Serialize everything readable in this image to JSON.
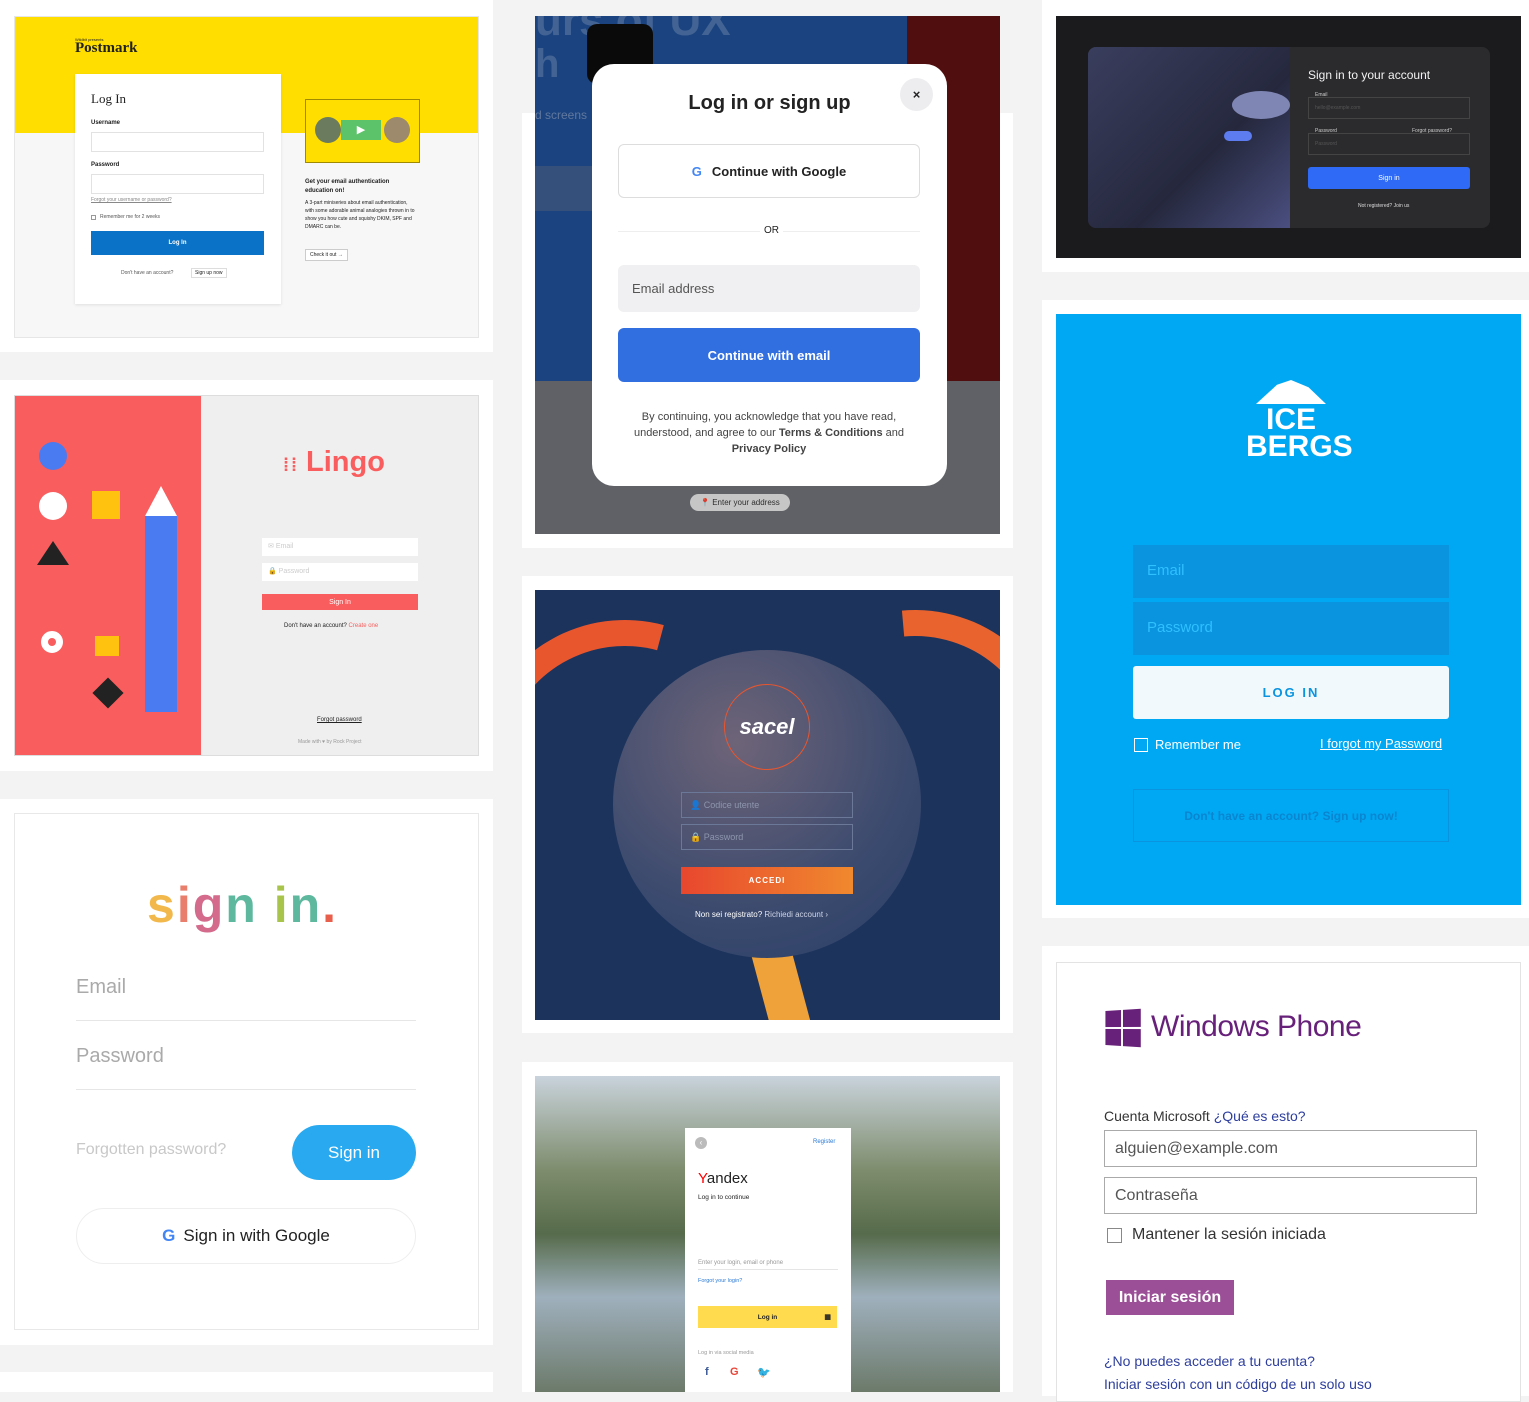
{
  "postmark": {
    "tagline": "Wildbit presents",
    "brand": "Postmark",
    "title": "Log In",
    "username_label": "Username",
    "password_label": "Password",
    "forgot": "Forgot your username or password?",
    "remember": "Remember me for 2 weeks",
    "login": "Log In",
    "no_account": "Don't have an account?",
    "signup": "Sign up now",
    "promo_title": "Get your email authentication education on!",
    "promo_text": "A 3-part miniseries about email authentication, with some adorable animal analogies thrown in to show you how cute and squishy DKIM, SPF and DMARC can be.",
    "promo_button": "Check it out →",
    "colors": {
      "yellow": "#ffde00",
      "blue": "#0b73c7"
    }
  },
  "tiktok": {
    "bg_fragments": [
      "urs of UX",
      "h",
      "d screens"
    ],
    "title": "Log in or sign up",
    "close": "×",
    "google": "Continue with Google",
    "or": "OR",
    "email_placeholder": "Email address",
    "continue_email": "Continue with email",
    "legal_pre": "By continuing, you acknowledge that you have read, understood, and agree to our ",
    "terms": "Terms & Conditions",
    "legal_and": " and ",
    "privacy": "Privacy Policy",
    "address_placeholder": "Enter your address",
    "colors": {
      "accent": "#316ee0"
    }
  },
  "dark": {
    "title": "Sign in to your account",
    "email_label": "Email",
    "email_placeholder": "hello@example.com",
    "password_label": "Password",
    "forgot": "Forgot password?",
    "password_placeholder": "Password",
    "signin": "Sign in",
    "not_registered": "Not registered?",
    "join": "Join us",
    "colors": {
      "accent": "#2e6af5"
    }
  },
  "lingo": {
    "brand": "Lingo",
    "email_placeholder": "Email",
    "password_placeholder": "Password",
    "signin": "Sign In",
    "no_account": "Don't have an account?",
    "create": "Create one",
    "forgot": "Forgot password",
    "footer": "Made with ♥ by Rock Project",
    "colors": {
      "red": "#f95d5d"
    }
  },
  "sacel": {
    "brand": "sacel",
    "user_placeholder": "Codice utente",
    "password_placeholder": "Password",
    "login": "ACCEDI",
    "not_registered": "Non sei registrato?",
    "request": "Richiedi account ›",
    "colors": {
      "navy": "#1c335c",
      "orange": "#e8562e"
    }
  },
  "icebergs": {
    "logo": "ICE BERGS",
    "email_placeholder": "Email",
    "password_placeholder": "Password",
    "login": "LOG IN",
    "remember": "Remember me",
    "forgot": "I forgot my Password",
    "signup": "Don't have an account? Sign up now!",
    "colors": {
      "blue": "#00a8f4"
    }
  },
  "signin": {
    "title_parts": [
      "s",
      "i",
      "g",
      "n",
      " ",
      "i",
      "n",
      "."
    ],
    "email_placeholder": "Email",
    "password_placeholder": "Password",
    "forgot": "Forgotten password?",
    "signin": "Sign in",
    "google": "Sign in with Google"
  },
  "yandex": {
    "brand_y": "Y",
    "brand_rest": "andex",
    "subtitle": "Log in to continue",
    "register": "Register",
    "login_placeholder": "Enter your login, email or phone",
    "forgot": "Forgot your login?",
    "login": "Log in",
    "social": "Log in via social media"
  },
  "windows": {
    "brand": "Windows Phone",
    "account_label": "Cuenta Microsoft",
    "what": "¿Qué es esto?",
    "email_placeholder": "alguien@example.com",
    "password_placeholder": "Contraseña",
    "keep": "Mantener la sesión iniciada",
    "signin": "Iniciar sesión",
    "cant_access": "¿No puedes acceder a tu cuenta?",
    "single_use": "Iniciar sesión con un código de un solo uso",
    "colors": {
      "purple": "#68217a",
      "button": "#9b4f96"
    }
  }
}
